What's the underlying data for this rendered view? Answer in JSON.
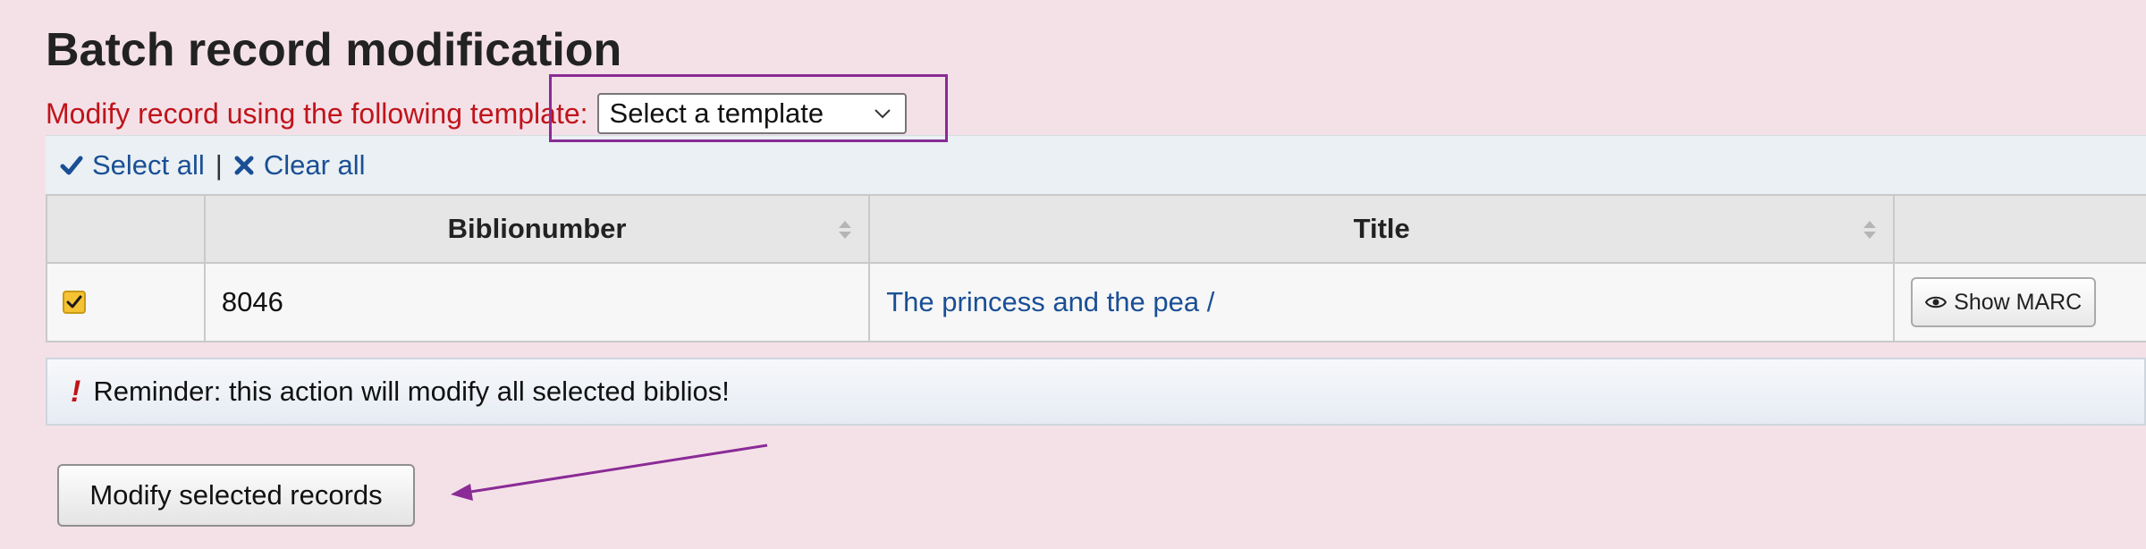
{
  "page": {
    "title": "Batch record modification"
  },
  "template": {
    "label": "Modify record using the following template:",
    "selected": "Select a template"
  },
  "selection": {
    "select_all": "Select all",
    "separator": "|",
    "clear_all": "Clear all"
  },
  "table": {
    "columns": [
      "",
      "Biblionumber",
      "Title",
      ""
    ],
    "rows": [
      {
        "checked": true,
        "biblionumber": "8046",
        "title": "The princess and the pea /",
        "action": "Show MARC"
      }
    ]
  },
  "reminder": {
    "icon": "!",
    "text": "Reminder: this action will modify all selected biblios!"
  },
  "submit": {
    "label": "Modify selected records"
  },
  "colors": {
    "background": "#f4e1e8",
    "label_red": "#c0141a",
    "link_blue": "#1a4f95",
    "annotation_purple": "#8a2b96",
    "checkbox_yellow": "#f5c233"
  }
}
